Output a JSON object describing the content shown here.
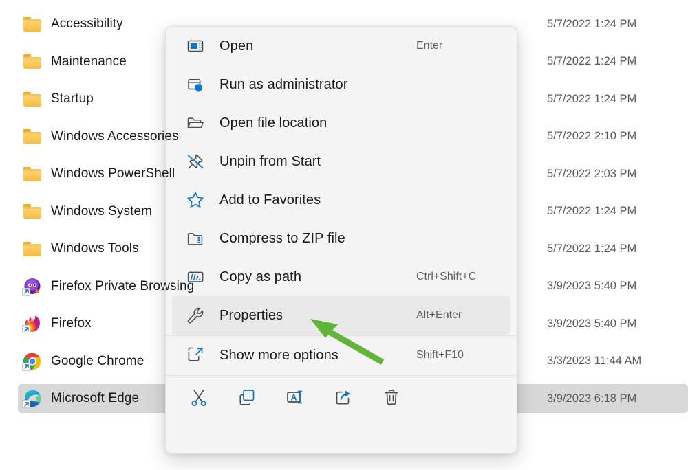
{
  "file_list": {
    "column_date_header_hidden": true,
    "rows": [
      {
        "icon": "folder-icon",
        "name": "Accessibility",
        "date": "5/7/2022 1:24 PM",
        "selected": false
      },
      {
        "icon": "folder-icon",
        "name": "Maintenance",
        "date": "5/7/2022 1:24 PM",
        "selected": false
      },
      {
        "icon": "folder-icon",
        "name": "Startup",
        "date": "5/7/2022 1:24 PM",
        "selected": false
      },
      {
        "icon": "folder-icon",
        "name": "Windows Accessories",
        "date": "5/7/2022 2:10 PM",
        "selected": false
      },
      {
        "icon": "folder-icon",
        "name": "Windows PowerShell",
        "date": "5/7/2022 2:03 PM",
        "selected": false
      },
      {
        "icon": "folder-icon",
        "name": "Windows System",
        "date": "5/7/2022 1:24 PM",
        "selected": false
      },
      {
        "icon": "folder-icon",
        "name": "Windows Tools",
        "date": "5/7/2022 1:24 PM",
        "selected": false
      },
      {
        "icon": "firefox-private-browsing-icon",
        "name": "Firefox Private Browsing",
        "date": "3/9/2023 5:40 PM",
        "selected": false
      },
      {
        "icon": "firefox-icon",
        "name": "Firefox",
        "date": "3/9/2023 5:40 PM",
        "selected": false
      },
      {
        "icon": "google-chrome-icon",
        "name": "Google Chrome",
        "date": "3/3/2023 11:44 AM",
        "selected": false
      },
      {
        "icon": "microsoft-edge-icon",
        "name": "Microsoft Edge",
        "date": "3/9/2023 6:18 PM",
        "selected": true
      }
    ]
  },
  "context_menu": {
    "items": [
      {
        "icon": "open-window-icon",
        "label": "Open",
        "shortcut": "Enter",
        "highlight": false
      },
      {
        "icon": "shield-window-icon",
        "label": "Run as administrator",
        "shortcut": "",
        "highlight": false
      },
      {
        "icon": "folder-open-icon",
        "label": "Open file location",
        "shortcut": "",
        "highlight": false
      },
      {
        "icon": "unpin-icon",
        "label": "Unpin from Start",
        "shortcut": "",
        "highlight": false
      },
      {
        "icon": "star-icon",
        "label": "Add to Favorites",
        "shortcut": "",
        "highlight": false
      },
      {
        "icon": "zip-folder-icon",
        "label": "Compress to ZIP file",
        "shortcut": "",
        "highlight": false
      },
      {
        "icon": "copy-path-icon",
        "label": "Copy as path",
        "shortcut": "Ctrl+Shift+C",
        "highlight": false
      },
      {
        "icon": "wrench-icon",
        "label": "Properties",
        "shortcut": "Alt+Enter",
        "highlight": true
      }
    ],
    "show_more": {
      "icon": "show-more-options-icon",
      "label": "Show more options",
      "shortcut": "Shift+F10"
    },
    "icon_bar": [
      {
        "icon": "cut-icon",
        "label": "Cut"
      },
      {
        "icon": "copy-icon",
        "label": "Copy"
      },
      {
        "icon": "rename-icon",
        "label": "Rename"
      },
      {
        "icon": "share-icon",
        "label": "Share"
      },
      {
        "icon": "delete-icon",
        "label": "Delete"
      }
    ]
  },
  "annotation": {
    "arrow_color": "#62b43b",
    "arrow_points_to": "Properties"
  },
  "colors": {
    "accent_blue": "#0f76d0",
    "selection_gray": "#d8d8d8",
    "menu_bg": "#f4f4f4",
    "highlight_row": "#e9e9e9",
    "folder_yellow": "#fbc95c"
  }
}
